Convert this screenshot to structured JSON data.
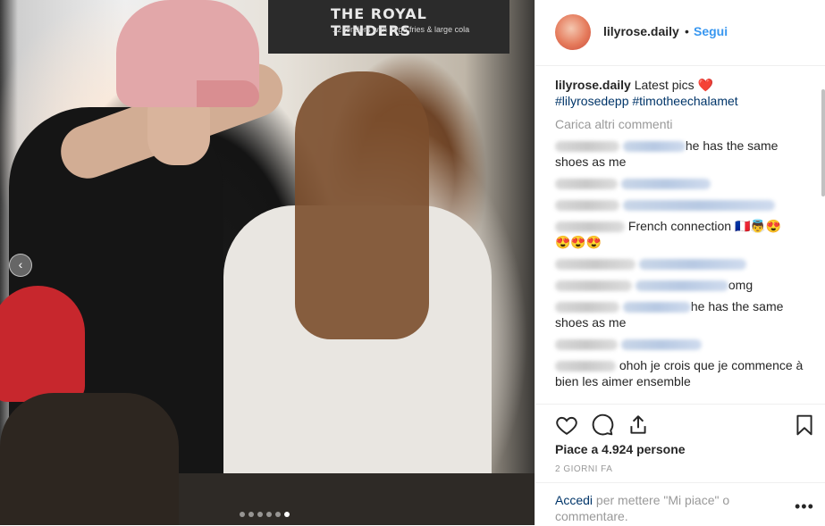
{
  "photo": {
    "sign_text": "THE ROYAL TENDERS",
    "sign_subtext": "12 tenders with large fries & large cola",
    "carousel_prev_icon": "chevron-left-icon",
    "carousel_dots": 6,
    "carousel_active_index": 5
  },
  "header": {
    "username": "lilyrose.daily",
    "separator": "•",
    "follow_label": "Segui"
  },
  "caption": {
    "username": "lilyrose.daily",
    "text": "Latest pics ❤️",
    "tags": "#lilyrosedepp #timotheechalamet"
  },
  "load_more": "Carica altri commenti",
  "comments": [
    {
      "text": "he has the same shoes as me"
    },
    {
      "text": ""
    },
    {
      "text": ""
    },
    {
      "text": "French connection 🇫🇷👼😍"
    },
    {
      "text": "😍😍😍"
    },
    {
      "text": ""
    },
    {
      "text": "omg"
    },
    {
      "text": "he has the same shoes as me"
    },
    {
      "text": ""
    },
    {
      "text": "ohoh je crois que je commence à bien les aimer ensemble"
    }
  ],
  "actions": {
    "like_icon": "heart-icon",
    "comment_icon": "comment-icon",
    "share_icon": "share-icon",
    "save_icon": "bookmark-icon"
  },
  "likes": "Piace a 4.924 persone",
  "date": "2 GIORNI FA",
  "footer": {
    "login_link": "Accedi",
    "login_text": " per mettere \"Mi piace\" o commentare.",
    "more_label": "•••"
  },
  "colors": {
    "link": "#3897f0",
    "tag": "#003569",
    "muted": "#999999",
    "text": "#262626"
  }
}
